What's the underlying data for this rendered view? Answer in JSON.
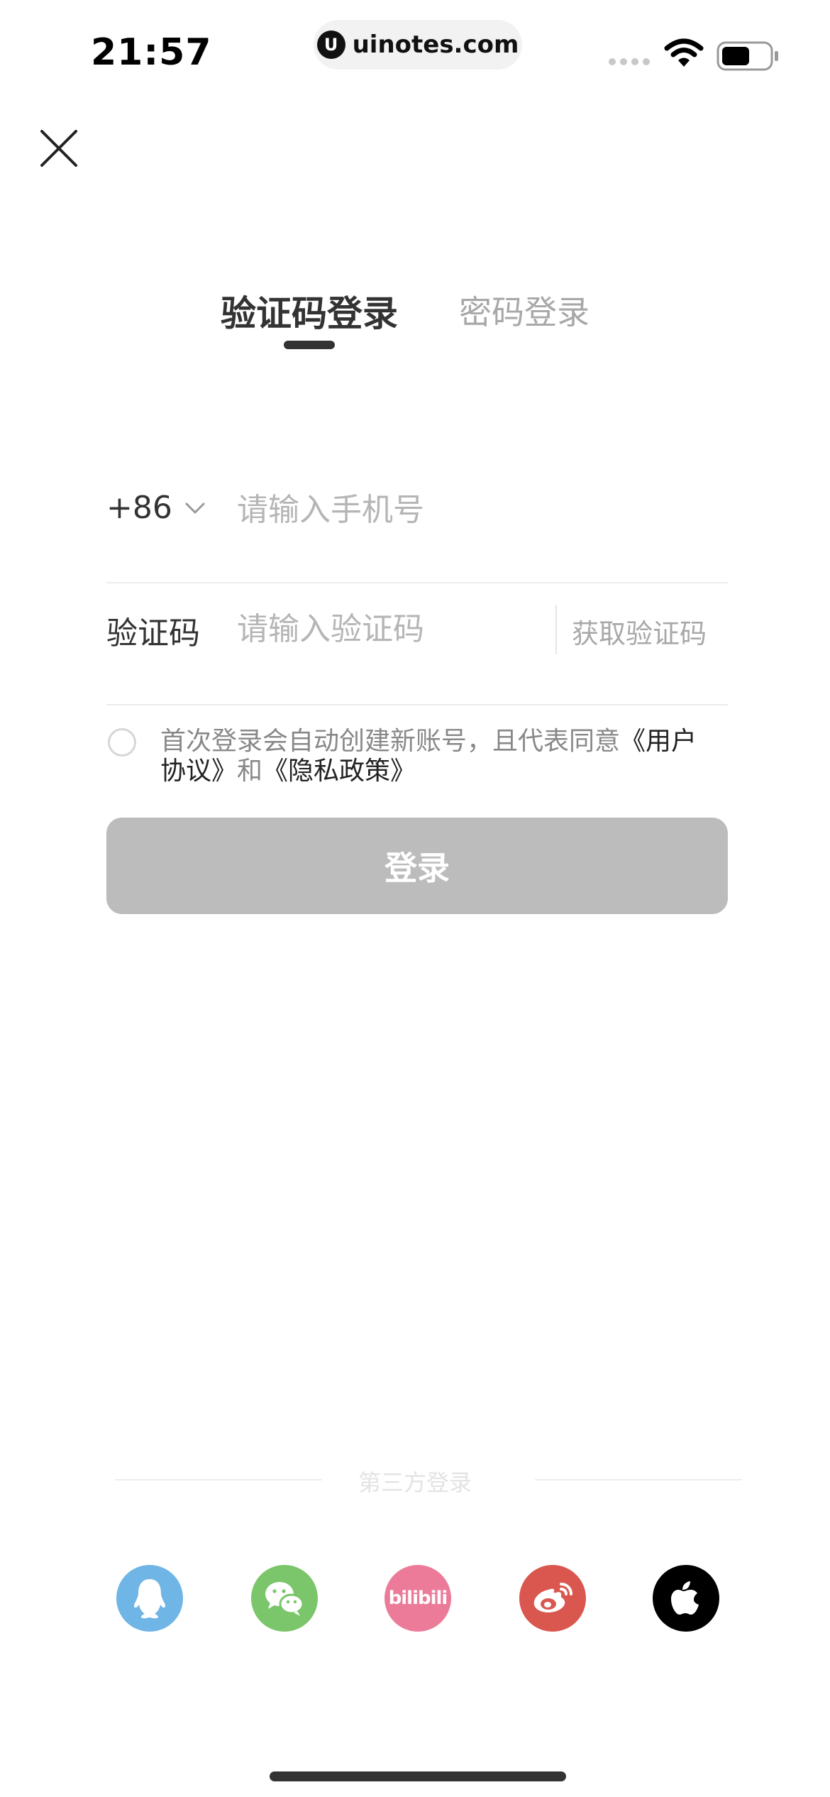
{
  "status_bar": {
    "time": "21:57",
    "url": "uinotes.com",
    "url_logo_letter": "U"
  },
  "tabs": [
    {
      "label": "验证码登录",
      "active": true
    },
    {
      "label": "密码登录",
      "active": false
    }
  ],
  "form": {
    "country_code": "+86",
    "phone_placeholder": "请输入手机号",
    "phone_value": "",
    "code_label": "验证码",
    "code_placeholder": "请输入验证码",
    "code_value": "",
    "get_code_label": "获取验证码"
  },
  "agreement": {
    "text": "首次登录会自动创建新账号，且代表同意",
    "user_agreement": "《用户协议》",
    "and": "和",
    "privacy_policy": "《隐私政策》",
    "checked": false
  },
  "login_button": {
    "label": "登录"
  },
  "third_party": {
    "label": "第三方登录",
    "providers": [
      {
        "name": "QQ",
        "icon": "qq-icon",
        "color": "#6fb5e6"
      },
      {
        "name": "WeChat",
        "icon": "wechat-icon",
        "color": "#7bc56a"
      },
      {
        "name": "bilibili",
        "icon": "bilibili-icon",
        "color": "#ec7b9a",
        "logo_text": "bilibili"
      },
      {
        "name": "Weibo",
        "icon": "weibo-icon",
        "color": "#d9574f"
      },
      {
        "name": "Apple",
        "icon": "apple-icon",
        "color": "#000000"
      }
    ]
  },
  "colors": {
    "login_disabled": "#bcbcbc",
    "tab_active": "#333333",
    "tab_inactive": "#a8a8a8"
  }
}
